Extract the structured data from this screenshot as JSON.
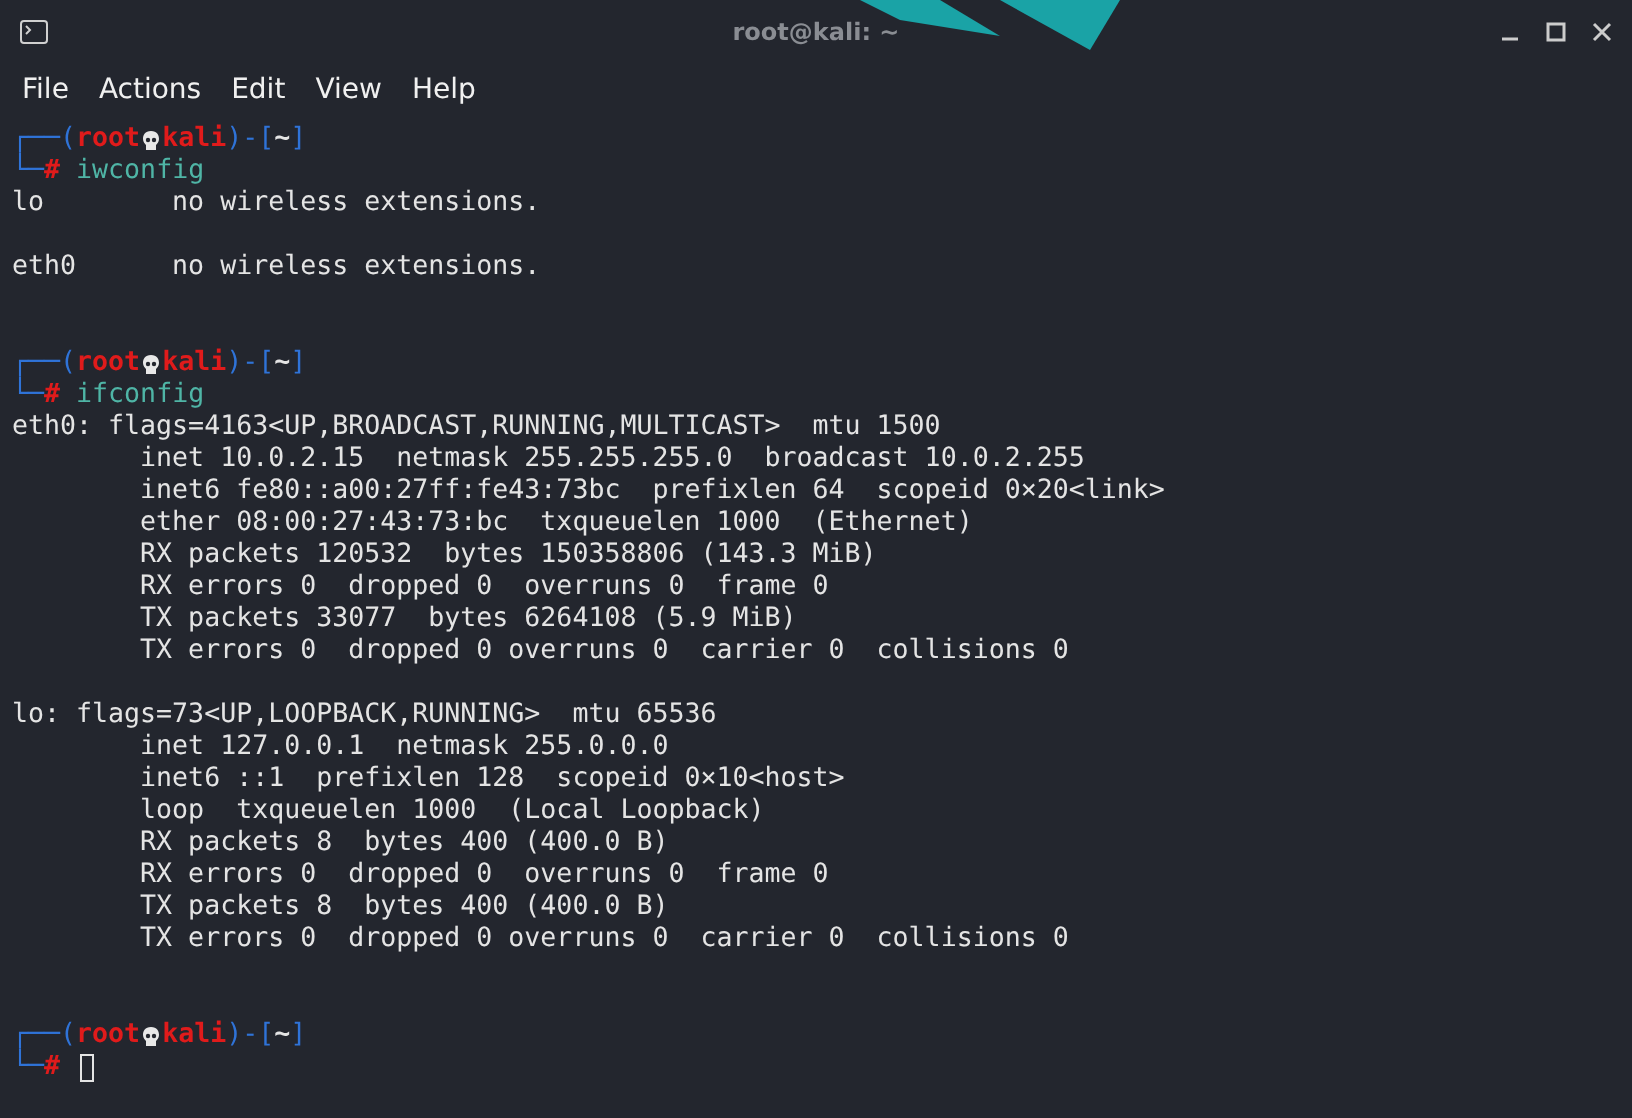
{
  "window": {
    "title": "root@kali: ~"
  },
  "menu": [
    "File",
    "Actions",
    "Edit",
    "View",
    "Help"
  ],
  "lines": [
    {
      "kind": "prompt",
      "open": "┌──(",
      "user": "root",
      "host": "kali",
      "mid": ")-[",
      "dir": "~",
      "close": "]"
    },
    {
      "kind": "command",
      "corner": "└─",
      "sign": "#",
      "text": "iwconfig"
    },
    {
      "kind": "output",
      "text": "lo        no wireless extensions."
    },
    {
      "kind": "blank"
    },
    {
      "kind": "output",
      "text": "eth0      no wireless extensions."
    },
    {
      "kind": "blank"
    },
    {
      "kind": "blank"
    },
    {
      "kind": "prompt",
      "open": "┌──(",
      "user": "root",
      "host": "kali",
      "mid": ")-[",
      "dir": "~",
      "close": "]"
    },
    {
      "kind": "command",
      "corner": "└─",
      "sign": "#",
      "text": "ifconfig"
    },
    {
      "kind": "output",
      "text": "eth0: flags=4163<UP,BROADCAST,RUNNING,MULTICAST>  mtu 1500"
    },
    {
      "kind": "output",
      "text": "        inet 10.0.2.15  netmask 255.255.255.0  broadcast 10.0.2.255"
    },
    {
      "kind": "output",
      "text": "        inet6 fe80::a00:27ff:fe43:73bc  prefixlen 64  scopeid 0×20<link>"
    },
    {
      "kind": "output",
      "text": "        ether 08:00:27:43:73:bc  txqueuelen 1000  (Ethernet)"
    },
    {
      "kind": "output",
      "text": "        RX packets 120532  bytes 150358806 (143.3 MiB)"
    },
    {
      "kind": "output",
      "text": "        RX errors 0  dropped 0  overruns 0  frame 0"
    },
    {
      "kind": "output",
      "text": "        TX packets 33077  bytes 6264108 (5.9 MiB)"
    },
    {
      "kind": "output",
      "text": "        TX errors 0  dropped 0 overruns 0  carrier 0  collisions 0"
    },
    {
      "kind": "blank"
    },
    {
      "kind": "output",
      "text": "lo: flags=73<UP,LOOPBACK,RUNNING>  mtu 65536"
    },
    {
      "kind": "output",
      "text": "        inet 127.0.0.1  netmask 255.0.0.0"
    },
    {
      "kind": "output",
      "text": "        inet6 ::1  prefixlen 128  scopeid 0×10<host>"
    },
    {
      "kind": "output",
      "text": "        loop  txqueuelen 1000  (Local Loopback)"
    },
    {
      "kind": "output",
      "text": "        RX packets 8  bytes 400 (400.0 B)"
    },
    {
      "kind": "output",
      "text": "        RX errors 0  dropped 0  overruns 0  frame 0"
    },
    {
      "kind": "output",
      "text": "        TX packets 8  bytes 400 (400.0 B)"
    },
    {
      "kind": "output",
      "text": "        TX errors 0  dropped 0 overruns 0  carrier 0  collisions 0"
    },
    {
      "kind": "blank"
    },
    {
      "kind": "blank"
    },
    {
      "kind": "prompt",
      "open": "┌──(",
      "user": "root",
      "host": "kali",
      "mid": ")-[",
      "dir": "~",
      "close": "]"
    },
    {
      "kind": "input",
      "corner": "└─",
      "sign": "#"
    }
  ]
}
